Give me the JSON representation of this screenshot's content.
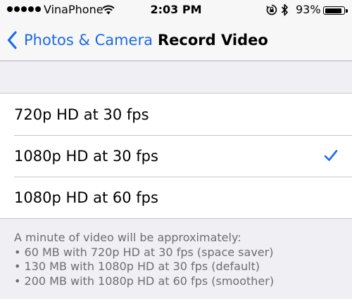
{
  "status_bar": {
    "carrier": "VinaPhone",
    "time": "2:03 PM",
    "battery_percent": "93%",
    "battery_level": 0.93,
    "icons": [
      "signal-dots-icon",
      "wifi-icon",
      "rotation-lock-icon",
      "bluetooth-icon",
      "battery-icon"
    ]
  },
  "nav": {
    "back_label": "Photos & Camera",
    "title": "Record Video"
  },
  "options": [
    {
      "label": "720p HD at 30 fps",
      "selected": false
    },
    {
      "label": "1080p HD at 30 fps",
      "selected": true
    },
    {
      "label": "1080p HD at 60 fps",
      "selected": false
    }
  ],
  "footer": {
    "lines": [
      "A minute of video will be approximately:",
      "• 60 MB with 720p HD at 30 fps (space saver)",
      "• 130 MB with 1080p HD at 30 fps (default)",
      "• 200 MB with 1080p HD at 60 fps (smoother)"
    ]
  },
  "colors": {
    "accent": "#1b6ae5",
    "background": "#efeff4",
    "footer_text": "#6d6d72"
  }
}
